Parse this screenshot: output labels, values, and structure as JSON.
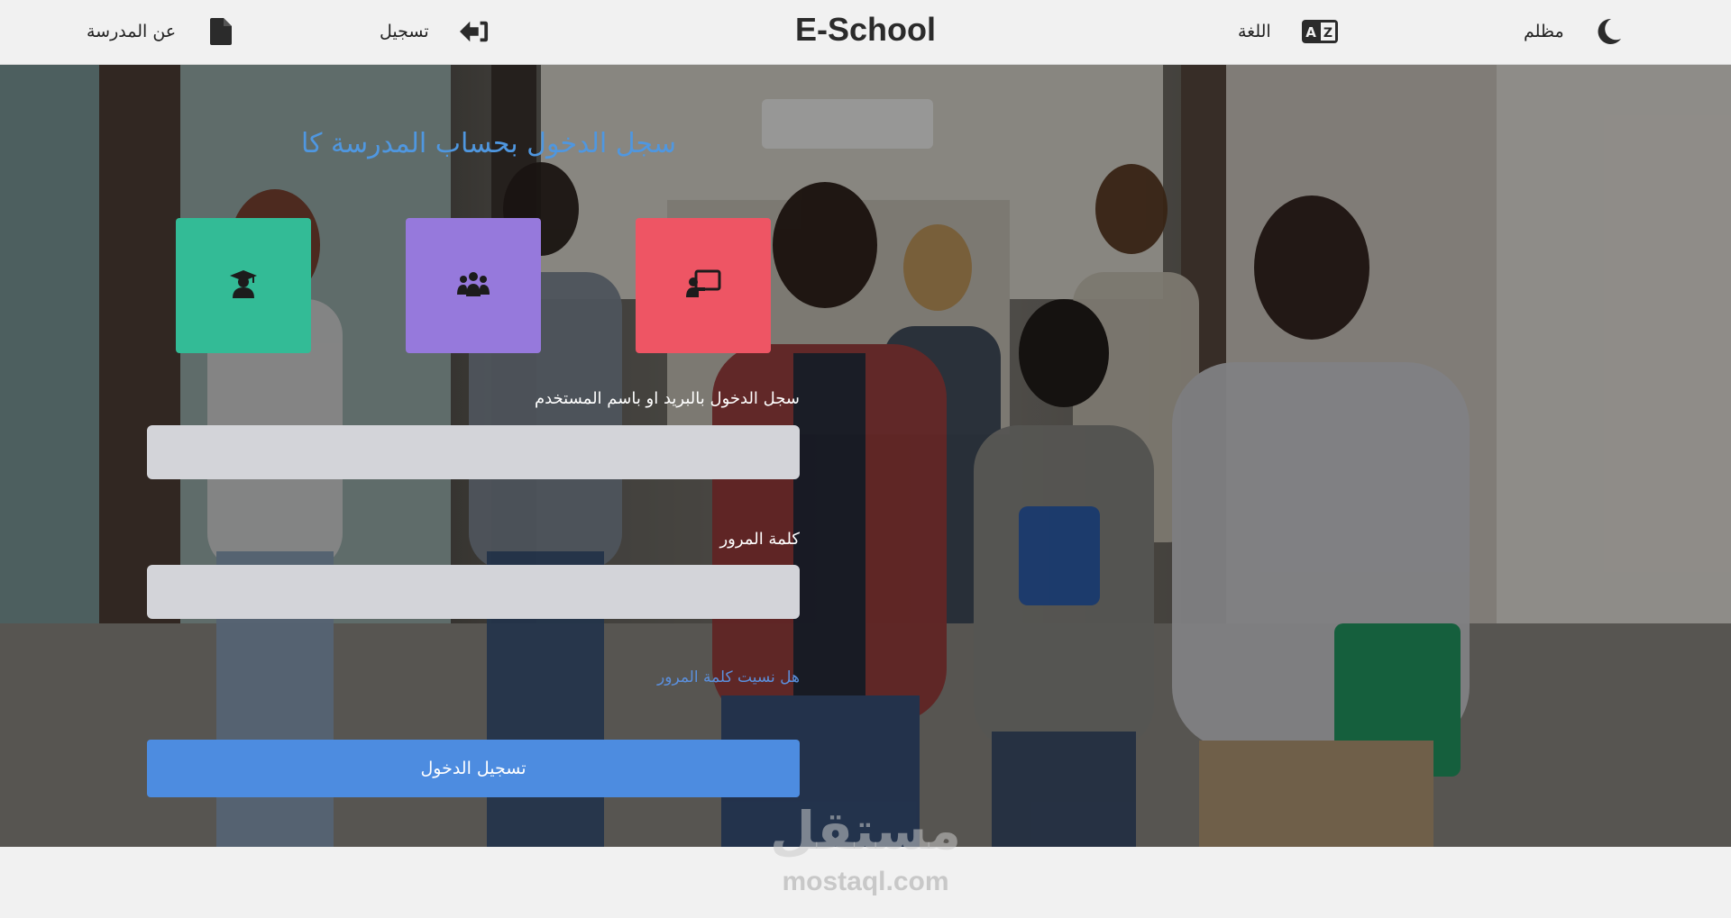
{
  "app": {
    "title": "E-School"
  },
  "nav": {
    "about_label": "عن المدرسة",
    "about_icon": "file-icon",
    "register_label": "تسجيل",
    "register_icon": "sign-in-icon",
    "language_label": "اللغة",
    "language_icon": "translate-icon",
    "theme_label": "مظلم",
    "theme_icon": "moon-icon"
  },
  "login": {
    "title": "سجل الدخول بحساب المدرسة كا",
    "roles": [
      {
        "icon": "graduate-icon",
        "color": "#33bb96"
      },
      {
        "icon": "users-group-icon",
        "color": "#9679dc"
      },
      {
        "icon": "teacher-board-icon",
        "color": "#ee5564"
      }
    ],
    "username_label": "سجل الدخول بالبريد او باسم المستخدم",
    "username_value": "",
    "password_label": "كلمة المرور",
    "password_value": "",
    "forgot_label": "هل نسيت كلمة المرور",
    "submit_label": "تسجيل الدخول"
  },
  "watermark": {
    "arabic": "مستقل",
    "latin": "mostaql.com"
  },
  "colors": {
    "accent": "#4d8ce0",
    "title": "#4f97e0",
    "topbar_bg": "#f1f1f1"
  }
}
